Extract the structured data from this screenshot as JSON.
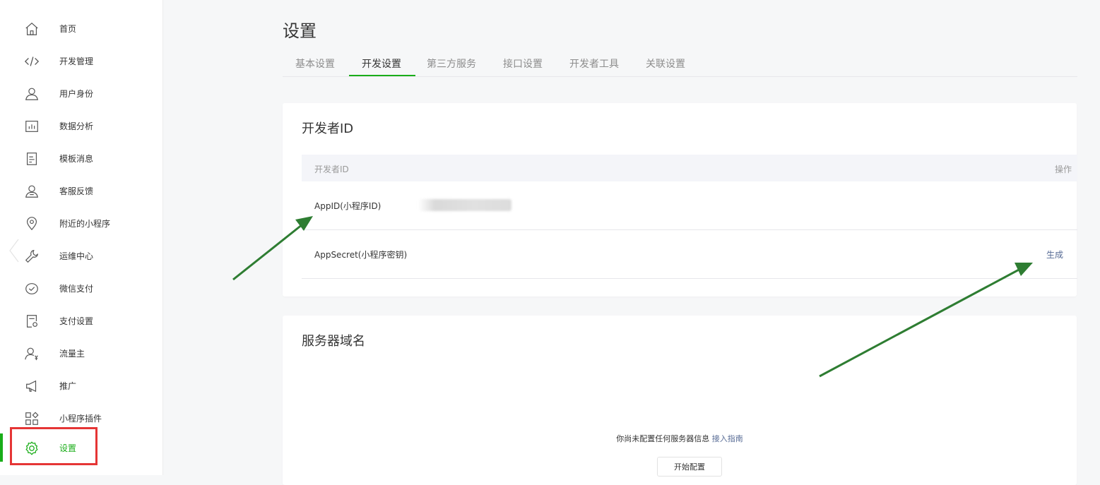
{
  "sidebar": {
    "items": [
      {
        "label": "首页",
        "icon": "home-icon"
      },
      {
        "label": "开发管理",
        "icon": "code-icon"
      },
      {
        "label": "用户身份",
        "icon": "user-icon"
      },
      {
        "label": "数据分析",
        "icon": "chart-icon"
      },
      {
        "label": "模板消息",
        "icon": "document-icon"
      },
      {
        "label": "客服反馈",
        "icon": "customer-service-icon"
      },
      {
        "label": "附近的小程序",
        "icon": "location-pin-icon"
      },
      {
        "label": "运维中心",
        "icon": "wrench-icon"
      },
      {
        "label": "微信支付",
        "icon": "wechat-pay-icon"
      },
      {
        "label": "支付设置",
        "icon": "payment-settings-icon"
      },
      {
        "label": "流量主",
        "icon": "traffic-owner-icon"
      },
      {
        "label": "推广",
        "icon": "megaphone-icon"
      },
      {
        "label": "小程序插件",
        "icon": "plugin-icon"
      },
      {
        "label": "设置",
        "icon": "gear-icon",
        "active": true
      }
    ]
  },
  "header": {
    "title": "设置"
  },
  "tabs": [
    {
      "label": "基本设置"
    },
    {
      "label": "开发设置",
      "active": true
    },
    {
      "label": "第三方服务"
    },
    {
      "label": "接口设置"
    },
    {
      "label": "开发者工具"
    },
    {
      "label": "关联设置"
    }
  ],
  "developer_id": {
    "title": "开发者ID",
    "columns": {
      "id": "开发者ID",
      "action": "操作"
    },
    "rows": [
      {
        "label": "AppID(小程序ID)",
        "value": "",
        "action": ""
      },
      {
        "label": "AppSecret(小程序密钥)",
        "value": "",
        "action": "生成"
      }
    ]
  },
  "server_domain": {
    "title": "服务器域名",
    "empty_text": "你尚未配置任何服务器信息",
    "guide_link": "接入指南",
    "start_button": "开始配置"
  },
  "colors": {
    "accent": "#1aad19",
    "link": "#576b95",
    "highlight": "#e53535",
    "annotation_arrow": "#2e7d32"
  }
}
